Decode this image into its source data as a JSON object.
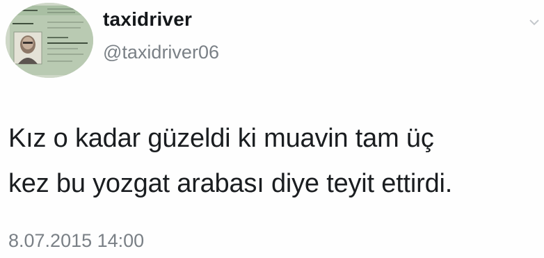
{
  "tweet": {
    "author": {
      "display_name": "taxidriver",
      "handle": "@taxidriver06",
      "avatar_icon": "id-card-avatar"
    },
    "text_lines": [
      "Kız o kadar güzeldi ki muavin tam üç",
      "kez bu yozgat arabası diye teyit ettirdi."
    ],
    "timestamp": "8.07.2015 14:00",
    "menu_icon": "chevron-down-icon"
  },
  "colors": {
    "text": "#14171a",
    "secondary": "#7a8086",
    "background": "#ffffff"
  }
}
